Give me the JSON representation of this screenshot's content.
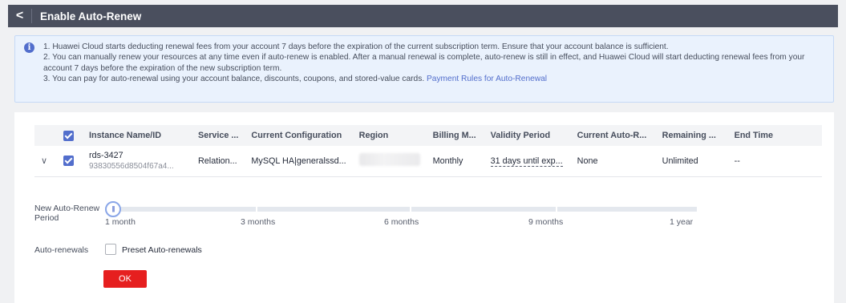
{
  "header": {
    "back_glyph": "<",
    "title": "Enable Auto-Renew"
  },
  "notice": {
    "line1": "1. Huawei Cloud starts deducting renewal fees from your account 7 days before the expiration of the current subscription term. Ensure that your account balance is sufficient.",
    "line2": "2. You can manually renew your resources at any time even if auto-renew is enabled. After a manual renewal is complete, auto-renew is still in effect, and Huawei Cloud will start deducting renewal fees from your account 7 days before the expiration of the new subscription term.",
    "line3": "3. You can pay for auto-renewal using your account balance, discounts, coupons, and stored-value cards.",
    "link": "Payment Rules for Auto-Renewal"
  },
  "table": {
    "columns": [
      "Instance Name/ID",
      "Service ...",
      "Current Configuration",
      "Region",
      "Billing M...",
      "Validity Period",
      "Current Auto-R...",
      "Remaining ...",
      "End Time"
    ],
    "row": {
      "name": "rds-3427",
      "id": "93830556d8504f67a4...",
      "service": "Relation...",
      "config": "MySQL HA|generalssd...",
      "billing": "Monthly",
      "validity": "31 days until exp...",
      "auto_renew": "None",
      "remaining": "Unlimited",
      "end_time": "--"
    }
  },
  "renew_period": {
    "label": "New Auto-Renew Period",
    "knob_glyph": "|||",
    "selected": "1 month",
    "options": [
      "1 month",
      "3 months",
      "6 months",
      "9 months",
      "1 year"
    ]
  },
  "auto_renewals": {
    "label": "Auto-renewals",
    "preset_label": "Preset Auto-renewals",
    "checked": false
  },
  "ok_label": "OK",
  "colors": {
    "header": "#4a4f5e",
    "accent": "#526ecc",
    "ok_button": "#e61f1f"
  }
}
